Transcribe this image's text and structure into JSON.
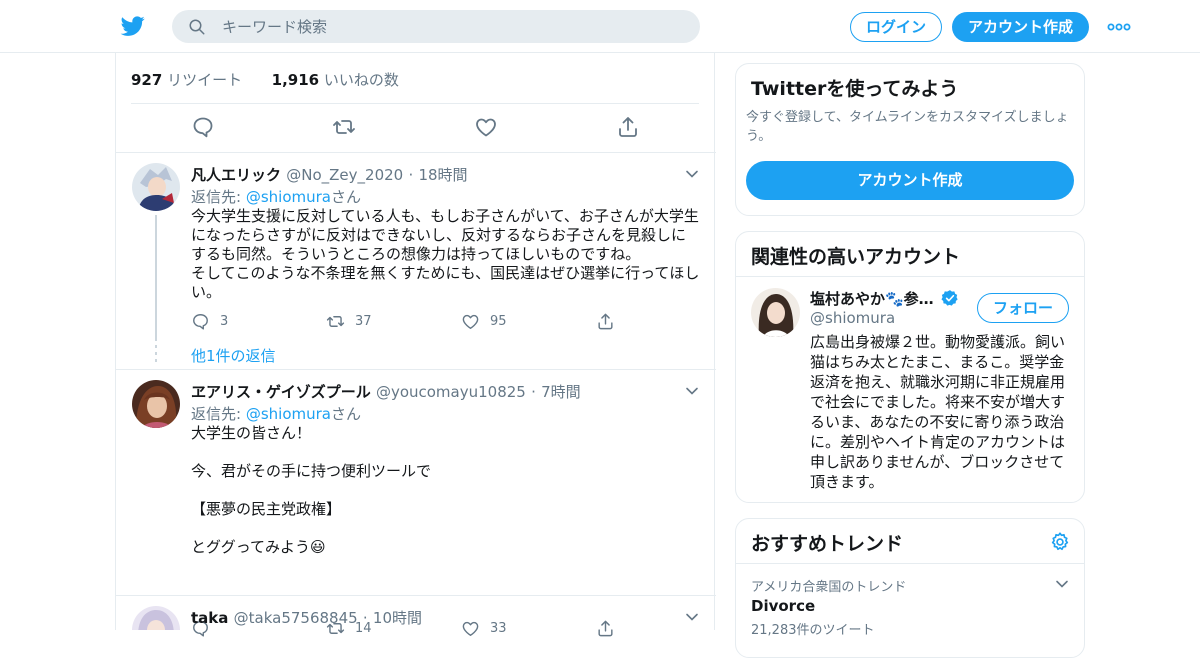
{
  "header": {
    "search_placeholder": "キーワード検索",
    "login_label": "ログイン",
    "signup_label": "アカウント作成",
    "accent": "#1da1f2"
  },
  "focused_tweet": {
    "retweet_count": "927",
    "retweet_label": "リツイート",
    "like_count": "1,916",
    "like_label": "いいねの数"
  },
  "replies": [
    {
      "name": "凡人エリック",
      "handle": "@No_Zey_2020",
      "dot": "·",
      "time": "18時間",
      "reply_prefix": "返信先: ",
      "reply_to": "@shiomura",
      "reply_suffix": "さん",
      "text": "今大学生支援に反対している人も、もしお子さんがいて、お子さんが大学生になったらさすがに反対はできないし、反対するならお子さんを見殺しにするも同然。そういうところの想像力は持ってほしいものですね。\nそしてこのような不条理を無くすためにも、国民達はぜひ選挙に行ってほしい。",
      "replies": "3",
      "retweets": "37",
      "likes": "95",
      "more_replies": "他1件の返信"
    },
    {
      "name": "ヱアリス・ゲイゾズプール",
      "handle": "@youcomayu10825",
      "dot": "·",
      "time": "7時間",
      "reply_prefix": "返信先: ",
      "reply_to": "@shiomura",
      "reply_suffix": "さん",
      "text": "大学生の皆さん！\n\n今、君がその手に持つ便利ツールで\n\n【悪夢の民主党政権】\n\nとググってみよう😃",
      "replies": "",
      "retweets": "14",
      "likes": "33"
    },
    {
      "name": "taka",
      "handle": "@taka57568845",
      "dot": "·",
      "time": "10時間"
    }
  ],
  "sidebar": {
    "signup_card": {
      "title": "Twitterを使ってみよう",
      "subtitle": "今すぐ登録して、タイムラインをカスタマイズしましょう。",
      "button": "アカウント作成"
    },
    "related": {
      "title": "関連性の高いアカウント",
      "name": "塩村あやか🐾参…",
      "handle": "@shiomura",
      "follow": "フォロー",
      "bio": "広島出身被爆２世。動物愛護派。飼い猫はちみ太とたまこ、まるこ。奨学金返済を抱え、就職氷河期に非正規雇用で社会にでました。将来不安が増大するいま、あなたの不安に寄り添う政治に。差別やヘイト肯定のアカウントは申し訳ありませんが、ブロックさせて頂きます。"
    },
    "trends": {
      "title": "おすすめトレンド",
      "location": "アメリカ合衆国のトレンド",
      "name": "Divorce",
      "count": "21,283件のツイート"
    }
  }
}
